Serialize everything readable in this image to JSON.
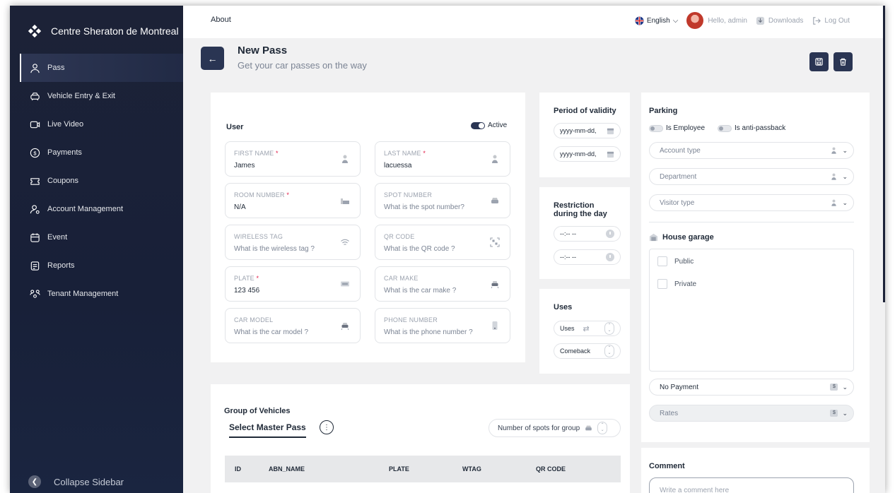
{
  "app": {
    "brand": "Centre Sheraton de Montreal"
  },
  "sidebar": {
    "items": [
      {
        "label": "Pass",
        "icon": "user-icon"
      },
      {
        "label": "Vehicle Entry & Exit",
        "icon": "car-icon"
      },
      {
        "label": "Live Video",
        "icon": "video-icon"
      },
      {
        "label": "Payments",
        "icon": "dollar-icon"
      },
      {
        "label": "Coupons",
        "icon": "coupon-icon"
      },
      {
        "label": "Account Management",
        "icon": "account-icon"
      },
      {
        "label": "Event",
        "icon": "calendar-icon"
      },
      {
        "label": "Reports",
        "icon": "report-icon"
      },
      {
        "label": "Tenant Management",
        "icon": "tenant-icon"
      }
    ],
    "active_index": 0,
    "collapse_label": "Collapse Sidebar"
  },
  "topbar": {
    "about": "About",
    "language": "English",
    "greeting": "Hello, admin",
    "downloads": "Downloads",
    "logout": "Log Out"
  },
  "page": {
    "title": "New Pass",
    "subtitle": "Get your car passes on the way"
  },
  "user_panel": {
    "title": "User",
    "active_label": "Active",
    "fields": {
      "first_name": {
        "label": "FIRST NAME",
        "required": "*",
        "value": "James"
      },
      "last_name": {
        "label": "LAST NAME",
        "required": "*",
        "value": "lacuessa"
      },
      "room_number": {
        "label": "ROOM NUMBER",
        "required": "*",
        "value": "N/A"
      },
      "spot_number": {
        "label": "SPOT NUMBER",
        "placeholder": "What is the spot number?"
      },
      "wireless_tag": {
        "label": "WIRELESS TAG",
        "placeholder": "What is the wireless tag ?"
      },
      "qr_code": {
        "label": "QR CODE",
        "placeholder": "What is the QR code ?"
      },
      "plate": {
        "label": "PLATE",
        "required": "*",
        "value": "123 456"
      },
      "car_make": {
        "label": "CAR MAKE",
        "placeholder": "What is the car make ?"
      },
      "car_model": {
        "label": "CAR MODEL",
        "placeholder": "What is the car model ?"
      },
      "phone_number": {
        "label": "PHONE NUMBER",
        "placeholder": "What is the phone number ?"
      }
    }
  },
  "validity": {
    "title": "Period of validity",
    "start_placeholder": "yyyy-mm-dd,",
    "end_placeholder": "yyyy-mm-dd,"
  },
  "restriction": {
    "title_line1": "Restriction",
    "title_line2": "during the day",
    "start_time": "--:-- --",
    "end_time": "--:-- --"
  },
  "uses": {
    "title": "Uses",
    "uses_label": "Uses",
    "comeback_label": "Comeback"
  },
  "parking": {
    "title": "Parking",
    "is_employee": "Is Employee",
    "is_antipassback": "Is anti-passback",
    "account_type": "Account type",
    "department": "Department",
    "visitor_type": "Visitor type",
    "garage_title": "House garage",
    "garage_options": [
      "Public",
      "Private"
    ],
    "payment": "No Payment",
    "rates": "Rates"
  },
  "group": {
    "title": "Group of Vehicles",
    "select_master": "Select Master Pass",
    "spots_label": "Number of spots for group",
    "columns": [
      "ID",
      "ABN_NAME",
      "PLATE",
      "WTAG",
      "QR CODE"
    ]
  },
  "comment": {
    "title": "Comment",
    "placeholder": "Write a comment here"
  },
  "colors": {
    "sidebar_bg": "#1c2237",
    "accent": "#2a3553",
    "required": "#e11d48"
  }
}
